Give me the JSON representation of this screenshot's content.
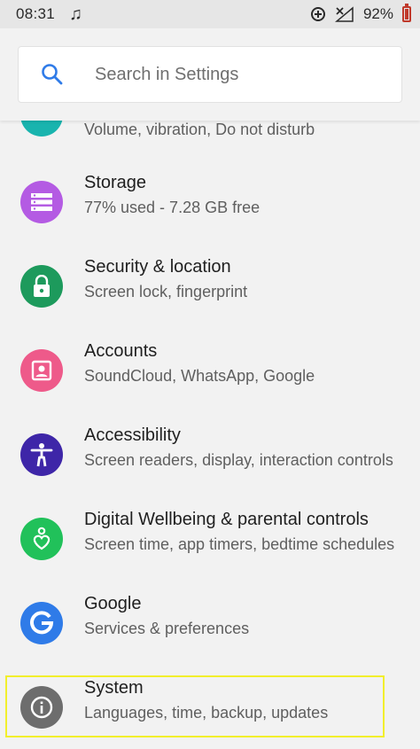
{
  "status_bar": {
    "time": "08:31",
    "battery_percent": "92%",
    "icons": [
      "music-note-icon",
      "data-saver-icon",
      "no-signal-icon",
      "battery-icon"
    ]
  },
  "search": {
    "placeholder": "Search in Settings",
    "icon": "search-icon"
  },
  "partial_item": {
    "subtitle": "Volume, vibration, Do not disturb",
    "icon": "sound-icon",
    "color": "#19b4ae"
  },
  "items": [
    {
      "title": "Storage",
      "subtitle": "77% used - 7.28 GB free",
      "icon": "storage-icon",
      "color": "#b45be3"
    },
    {
      "title": "Security & location",
      "subtitle": "Screen lock, fingerprint",
      "icon": "lock-icon",
      "color": "#1d9a5c"
    },
    {
      "title": "Accounts",
      "subtitle": "SoundCloud, WhatsApp, Google",
      "icon": "account-icon",
      "color": "#ee5a8a"
    },
    {
      "title": "Accessibility",
      "subtitle": "Screen readers, display, interaction controls",
      "icon": "accessibility-icon",
      "color": "#3e26a8"
    },
    {
      "title": "Digital Wellbeing & parental controls",
      "subtitle": "Screen time, app timers, bedtime schedules",
      "icon": "wellbeing-icon",
      "color": "#21c15a"
    },
    {
      "title": "Google",
      "subtitle": "Services & preferences",
      "icon": "google-icon",
      "color": "#2f7be8"
    },
    {
      "title": "System",
      "subtitle": "Languages, time, backup, updates",
      "icon": "info-icon",
      "color": "#6d6d6d"
    }
  ],
  "highlight_color": "#f2ef2c"
}
